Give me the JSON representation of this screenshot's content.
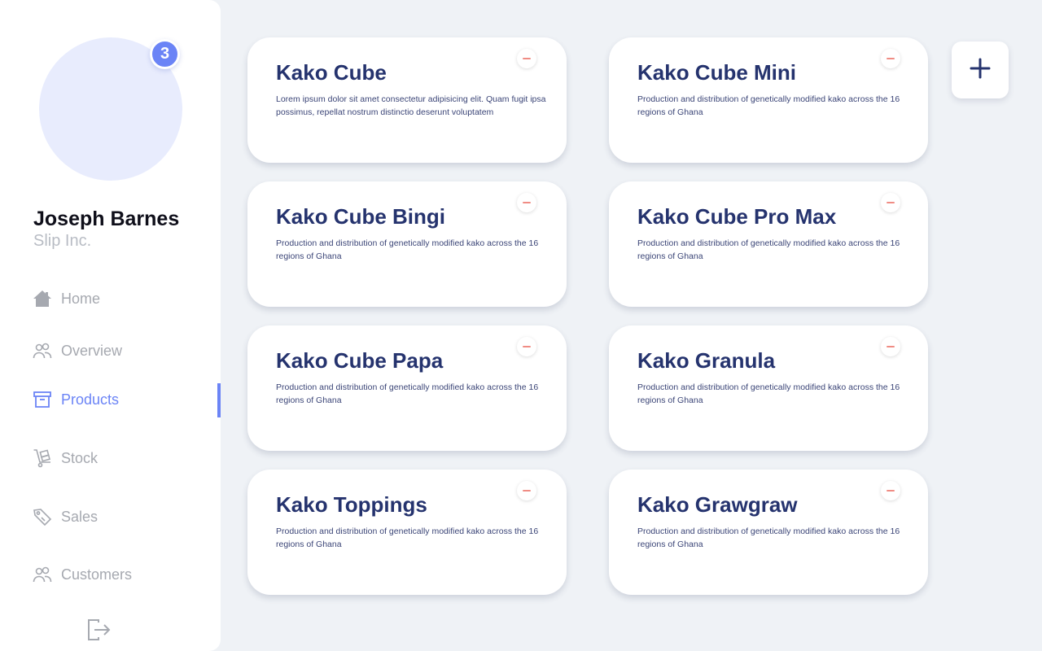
{
  "user": {
    "name": "Joseph Barnes",
    "company": "Slip Inc.",
    "notification_count": "3"
  },
  "nav": {
    "items": [
      {
        "label": "Home",
        "icon": "home-icon"
      },
      {
        "label": "Overview",
        "icon": "users-icon"
      },
      {
        "label": "Products",
        "icon": "archive-box-icon",
        "active": true
      },
      {
        "label": "Stock",
        "icon": "hand-truck-icon"
      },
      {
        "label": "Sales",
        "icon": "price-tag-icon"
      },
      {
        "label": "Customers",
        "icon": "users-icon"
      }
    ],
    "logout_icon": "logout-icon"
  },
  "products": [
    {
      "title": "Kako Cube",
      "description": "Lorem ipsum dolor sit amet consectetur adipisicing elit. Quam fugit ipsa possimus, repellat nostrum distinctio deserunt voluptatem"
    },
    {
      "title": "Kako Cube Mini",
      "description": "Production and distribution of genetically modified kako across the 16 regions of Ghana"
    },
    {
      "title": "Kako Cube Bingi",
      "description": "Production and distribution of genetically modified kako across the 16 regions of Ghana"
    },
    {
      "title": "Kako Cube Pro Max",
      "description": "Production and distribution of genetically modified kako across the 16 regions of Ghana"
    },
    {
      "title": "Kako Cube Papa",
      "description": "Production and distribution of genetically modified kako across the 16 regions of Ghana"
    },
    {
      "title": "Kako Granula",
      "description": "Production and distribution of genetically modified kako across the 16 regions of Ghana"
    },
    {
      "title": "Kako Toppings",
      "description": "Production and distribution of genetically modified kako across the 16 regions of Ghana"
    },
    {
      "title": "Kako Grawgraw",
      "description": "Production and distribution of genetically modified kako across the 16 regions of Ghana"
    }
  ],
  "actions": {
    "add_icon": "plus-icon",
    "remove_icon": "minus-icon"
  },
  "colors": {
    "accent": "#6b84f6",
    "title": "#25336e",
    "remove": "#f08c84",
    "background": "#eff2f6"
  }
}
